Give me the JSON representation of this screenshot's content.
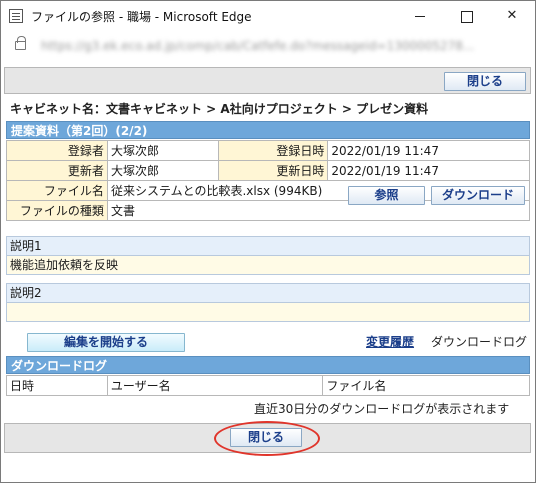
{
  "window": {
    "title": "ファイルの参照 - 職場 - Microsoft Edge",
    "url": "https://g3.ek.eco.ad.jp/comp/cab/Catfefe.do?messageid=1300005278..."
  },
  "toolbar": {
    "close_label": "閉じる"
  },
  "breadcrumb": "キャビネット名：文書キャビネット > A社向けプロジェクト > プレゼン資料",
  "document": {
    "header": "提案資料（第2回）(2/2)",
    "registrant_label": "登録者",
    "registrant_value": "大塚次郎",
    "reg_date_label": "登録日時",
    "reg_date_value": "2022/01/19 11:47",
    "updater_label": "更新者",
    "updater_value": "大塚次郎",
    "upd_date_label": "更新日時",
    "upd_date_value": "2022/01/19 11:47",
    "filename_label": "ファイル名",
    "filename_value": "従来システムとの比較表.xlsx (994KB)",
    "browse_label": "参照",
    "download_label": "ダウンロード",
    "filetype_label": "ファイルの種類",
    "filetype_value": "文書",
    "desc1_label": "説明1",
    "desc1_value": "機能追加依頼を反映",
    "desc2_label": "説明2",
    "desc2_value": ""
  },
  "actions": {
    "edit_label": "編集を開始する",
    "history_label": "変更履歴",
    "download_log_label": "ダウンロードログ"
  },
  "download_log": {
    "header": "ダウンロードログ",
    "columns": [
      "日時",
      "ユーザー名",
      "ファイル名"
    ],
    "note": "直近30日分のダウンロードログが表示されます"
  },
  "colors": {
    "header_bg": "#6ea7da",
    "label_bg": "#fff6d5",
    "highlight": "#e0352b"
  }
}
